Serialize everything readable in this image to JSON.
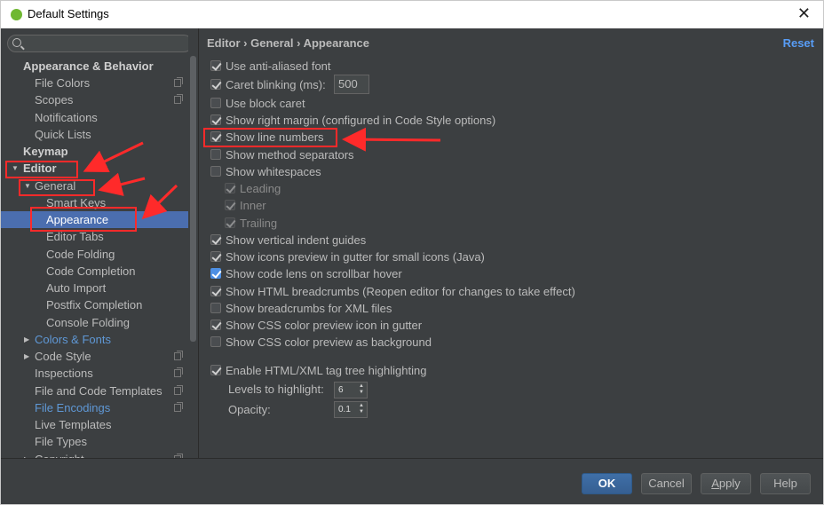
{
  "window": {
    "title": "Default Settings",
    "close_glyph": "✕"
  },
  "sidebar": {
    "search_placeholder": "",
    "items": [
      {
        "label": "Appearance & Behavior"
      },
      {
        "label": "File Colors"
      },
      {
        "label": "Scopes"
      },
      {
        "label": "Notifications"
      },
      {
        "label": "Quick Lists"
      },
      {
        "label": "Keymap"
      },
      {
        "label": "Editor",
        "arrow": "▼"
      },
      {
        "label": "General",
        "arrow": "▼"
      },
      {
        "label": "Smart Keys"
      },
      {
        "label": "Appearance"
      },
      {
        "label": "Editor Tabs"
      },
      {
        "label": "Code Folding"
      },
      {
        "label": "Code Completion"
      },
      {
        "label": "Auto Import"
      },
      {
        "label": "Postfix Completion"
      },
      {
        "label": "Console Folding"
      },
      {
        "label": "Colors & Fonts",
        "arrow": "▶"
      },
      {
        "label": "Code Style",
        "arrow": "▶"
      },
      {
        "label": "Inspections"
      },
      {
        "label": "File and Code Templates"
      },
      {
        "label": "File Encodings"
      },
      {
        "label": "Live Templates"
      },
      {
        "label": "File Types"
      },
      {
        "label": "Copyright",
        "arrow": "▶"
      }
    ]
  },
  "header": {
    "breadcrumb": "Editor › General › Appearance",
    "reset_label": "Reset"
  },
  "options": {
    "anti_aliased": {
      "label": "Use anti-aliased font",
      "checked": true
    },
    "caret_blinking": {
      "label": "Caret blinking (ms):",
      "checked": true,
      "value": "500"
    },
    "block_caret": {
      "label": "Use block caret",
      "checked": false
    },
    "right_margin": {
      "label": "Show right margin (configured in Code Style options)",
      "checked": true
    },
    "line_numbers": {
      "label": "Show line numbers",
      "checked": true
    },
    "method_separators": {
      "label": "Show method separators",
      "checked": false
    },
    "whitespaces": {
      "label": "Show whitespaces",
      "checked": false
    },
    "leading": {
      "label": "Leading",
      "checked": true
    },
    "inner": {
      "label": "Inner",
      "checked": true
    },
    "trailing": {
      "label": "Trailing",
      "checked": true
    },
    "indent_guides": {
      "label": "Show vertical indent guides",
      "checked": true
    },
    "icons_preview": {
      "label": "Show icons preview in gutter for small icons (Java)",
      "checked": true
    },
    "code_lens": {
      "label": "Show code lens on scrollbar hover",
      "checked": true
    },
    "html_breadcrumbs": {
      "label": "Show HTML breadcrumbs (Reopen editor for changes to take effect)",
      "checked": true
    },
    "xml_breadcrumbs": {
      "label": "Show breadcrumbs for XML files",
      "checked": false
    },
    "css_icon": {
      "label": "Show CSS color preview icon in gutter",
      "checked": true
    },
    "css_background": {
      "label": "Show CSS color preview as background",
      "checked": false
    },
    "tag_tree": {
      "label": "Enable HTML/XML tag tree highlighting",
      "checked": true
    },
    "levels": {
      "label": "Levels to highlight:",
      "value": "6"
    },
    "opacity": {
      "label": "Opacity:",
      "value": "0.1"
    }
  },
  "footer": {
    "ok_label": "OK",
    "cancel_label": "Cancel",
    "apply_label": "Apply",
    "apply_mnemonic": "A",
    "apply_rest": "pply",
    "help_label": "Help"
  },
  "colors": {
    "background": "#3c3f41",
    "selection": "#4b6eaf",
    "link": "#5f98d6",
    "annotation": "#ff2a2a"
  }
}
